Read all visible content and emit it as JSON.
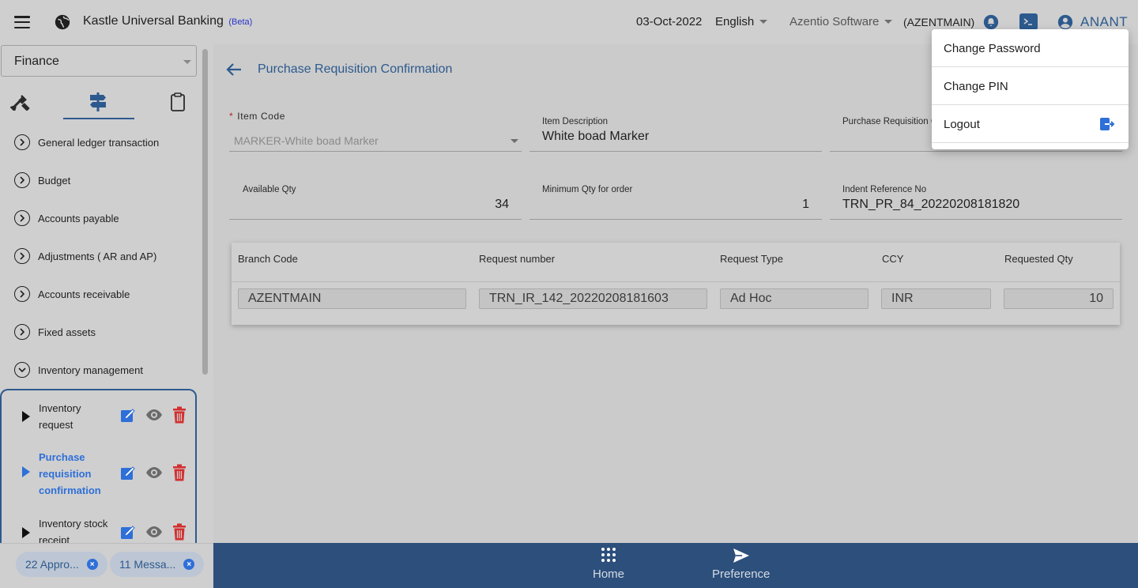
{
  "header": {
    "app_title": "Kastle Universal Banking",
    "beta_label": "(Beta)",
    "date": "03-Oct-2022",
    "language": "English",
    "company": "Azentio Software",
    "branch": "(AZENTMAIN)",
    "user": "ANANT"
  },
  "sidebar": {
    "module": "Finance",
    "menu_items": [
      {
        "label": "General ledger transaction",
        "state": "collapsed"
      },
      {
        "label": "Budget",
        "state": "collapsed"
      },
      {
        "label": "Accounts payable",
        "state": "collapsed"
      },
      {
        "label": "Adjustments ( AR and AP)",
        "state": "collapsed"
      },
      {
        "label": "Accounts receivable",
        "state": "collapsed"
      },
      {
        "label": "Fixed assets",
        "state": "collapsed"
      },
      {
        "label": "Inventory management",
        "state": "expanded"
      }
    ],
    "sub_items": [
      {
        "label": "Inventory request"
      },
      {
        "label": "Purchase requisition confirmation",
        "active": true
      },
      {
        "label": "Inventory stock receipt"
      }
    ],
    "chips": [
      {
        "label": "22 Appro..."
      },
      {
        "label": "11 Messa..."
      }
    ]
  },
  "main": {
    "title": "Purchase Requisition Confirmation",
    "fields": {
      "item_code": {
        "label": "Item Code",
        "value": "MARKER-White boad Marker"
      },
      "item_description": {
        "label": "Item Description",
        "value": "White boad Marker"
      },
      "purchase_requisition": {
        "label": "Purchase Requisition C",
        "value": ""
      },
      "available_qty": {
        "label": "Available Qty",
        "value": "34"
      },
      "minimum_qty": {
        "label": "Minimum Qty for order",
        "value": "1"
      },
      "indent_ref": {
        "label": "Indent Reference No",
        "value": "TRN_PR_84_20220208181820"
      }
    },
    "grid": {
      "headers": [
        "Branch Code",
        "Request number",
        "Request Type",
        "CCY",
        "Requested Qty"
      ],
      "rows": [
        [
          "AZENTMAIN",
          "TRN_IR_142_20220208181603",
          "Ad Hoc",
          "INR",
          "10"
        ]
      ]
    }
  },
  "bottom_nav": {
    "home": "Home",
    "preference": "Preference"
  },
  "user_menu": {
    "items": [
      "Change Password",
      "Change PIN",
      "Logout"
    ]
  },
  "colors": {
    "accent": "#2d5a8e",
    "active_blue": "#2e6fd8",
    "delete_red": "#d32f2f"
  }
}
